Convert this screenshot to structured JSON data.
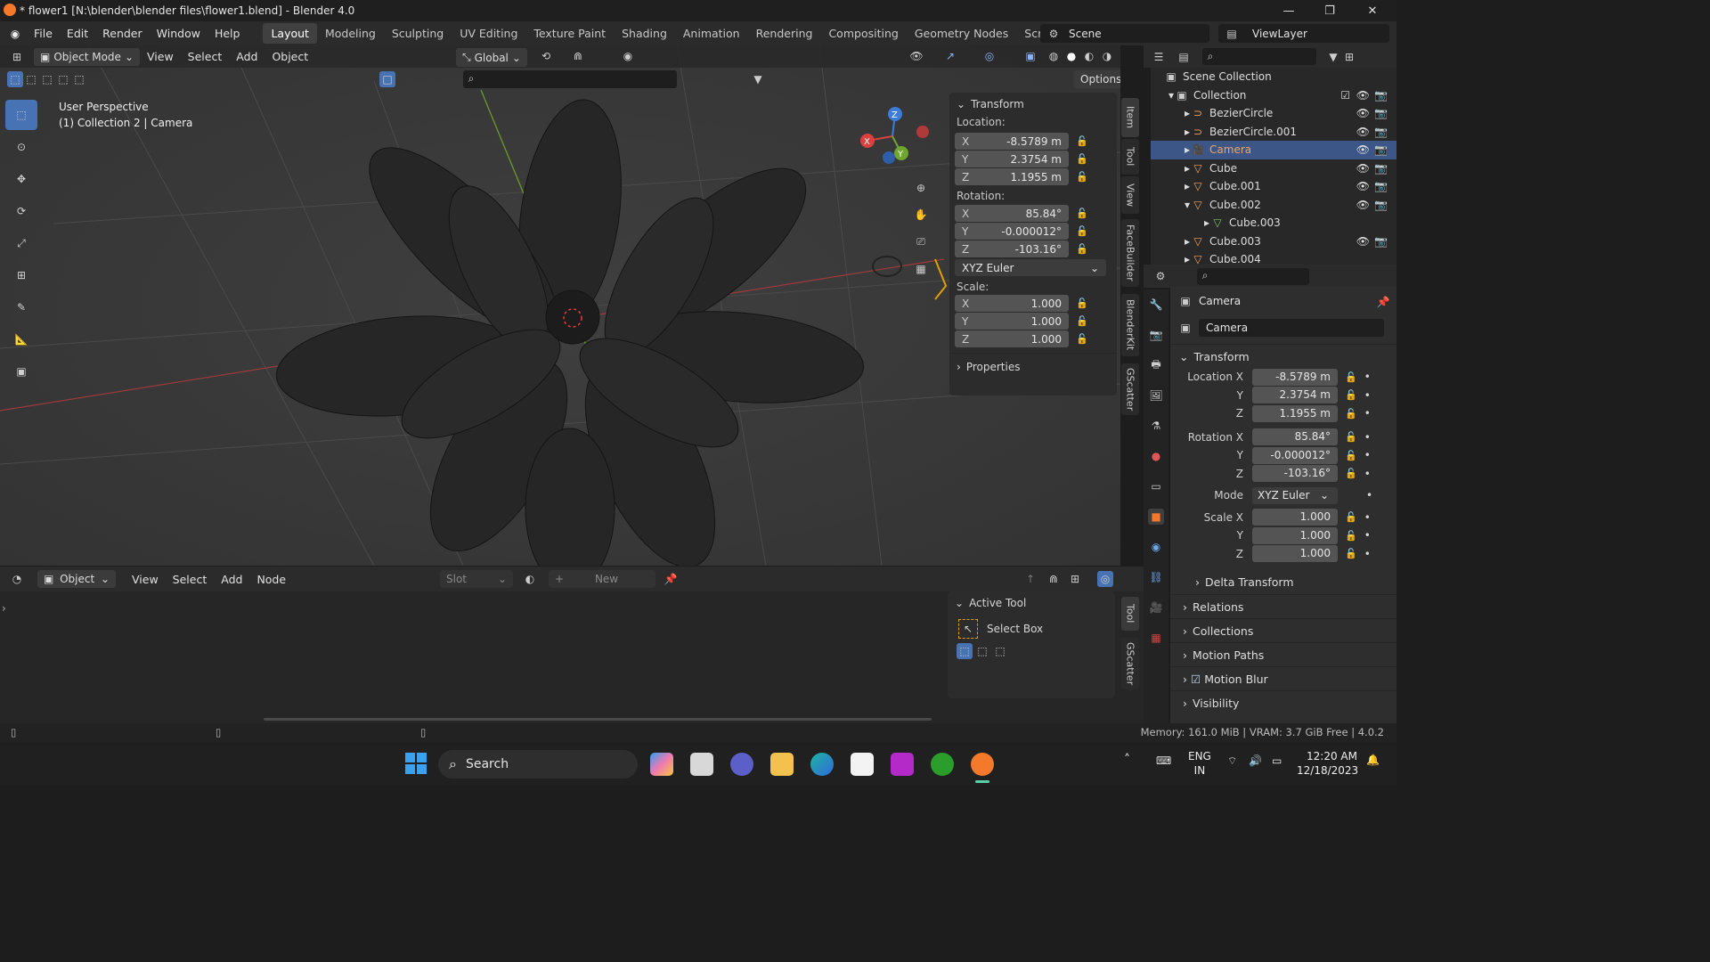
{
  "window": {
    "title": "* flower1 [N:\\blender\\blender files\\flower1.blend] - Blender 4.0",
    "min": "—",
    "max": "❐",
    "close": "✕"
  },
  "menubar": {
    "menus": [
      "File",
      "Edit",
      "Render",
      "Window",
      "Help"
    ],
    "workspaces": [
      "Layout",
      "Modeling",
      "Sculpting",
      "UV Editing",
      "Texture Paint",
      "Shading",
      "Animation",
      "Rendering",
      "Compositing",
      "Geometry Nodes",
      "Scripting"
    ],
    "add_workspace": "+",
    "scene": "Scene",
    "view_layer": "ViewLayer"
  },
  "viewport_header": {
    "mode": "Object Mode",
    "menus": [
      "View",
      "Select",
      "Add",
      "Object"
    ],
    "orientation": "Global",
    "options": "Options"
  },
  "viewport": {
    "overlay_line1": "User Perspective",
    "overlay_line2": "(1) Collection 2 | Camera",
    "gizmo": {
      "x": "X",
      "y": "Y",
      "z": "Z"
    }
  },
  "npanel": {
    "transform_title": "Transform",
    "location_label": "Location:",
    "location": [
      {
        "axis": "X",
        "value": "-8.5789 m"
      },
      {
        "axis": "Y",
        "value": "2.3754 m"
      },
      {
        "axis": "Z",
        "value": "1.1955 m"
      }
    ],
    "rotation_label": "Rotation:",
    "rotation": [
      {
        "axis": "X",
        "value": "85.84°"
      },
      {
        "axis": "Y",
        "value": "-0.000012°"
      },
      {
        "axis": "Z",
        "value": "-103.16°"
      }
    ],
    "rotation_mode": "XYZ Euler",
    "scale_label": "Scale:",
    "scale": [
      {
        "axis": "X",
        "value": "1.000"
      },
      {
        "axis": "Y",
        "value": "1.000"
      },
      {
        "axis": "Z",
        "value": "1.000"
      }
    ],
    "properties": "Properties",
    "tabs": [
      "Item",
      "Tool",
      "View",
      "FaceBuilder",
      "BlenderKit",
      "GScatter"
    ]
  },
  "outliner": {
    "scene_collection": "Scene Collection",
    "collection": "Collection",
    "items": [
      {
        "name": "BezierCircle"
      },
      {
        "name": "BezierCircle.001"
      },
      {
        "name": "Camera"
      },
      {
        "name": "Cube"
      },
      {
        "name": "Cube.001"
      },
      {
        "name": "Cube.002"
      },
      {
        "name": "Cube.003"
      },
      {
        "name": "Cube.003"
      },
      {
        "name": "Cube.004"
      }
    ]
  },
  "properties": {
    "object_name": "Camera",
    "datablock": "Camera",
    "transform": "Transform",
    "location": [
      {
        "label": "Location X",
        "value": "-8.5789 m"
      },
      {
        "label": "Y",
        "value": "2.3754 m"
      },
      {
        "label": "Z",
        "value": "1.1955 m"
      }
    ],
    "rotation": [
      {
        "label": "Rotation X",
        "value": "85.84°"
      },
      {
        "label": "Y",
        "value": "-0.000012°"
      },
      {
        "label": "Z",
        "value": "-103.16°"
      }
    ],
    "mode_label": "Mode",
    "mode_value": "XYZ Euler",
    "scale": [
      {
        "label": "Scale X",
        "value": "1.000"
      },
      {
        "label": "Y",
        "value": "1.000"
      },
      {
        "label": "Z",
        "value": "1.000"
      }
    ],
    "sections": [
      "Delta Transform",
      "Relations",
      "Collections",
      "Motion Paths",
      "Motion Blur",
      "Visibility"
    ]
  },
  "shader_editor": {
    "mode": "Object",
    "menus": [
      "View",
      "Select",
      "Add",
      "Node"
    ],
    "slot": "Slot",
    "new": "New",
    "active_tool_title": "Active Tool",
    "select_box": "Select Box",
    "tabs": [
      "Tool",
      "GScatter"
    ]
  },
  "statusbar": {
    "memory": "Memory: 161.0 MiB | VRAM: 3.7 GiB Free | 4.0.2"
  },
  "taskbar": {
    "search": "Search",
    "lang1": "ENG",
    "lang2": "IN",
    "time": "12:20 AM",
    "date": "12/18/2023"
  },
  "colors": {
    "accent": "#4772b3",
    "selection": "#3c5687",
    "blender_orange": "#f5792a"
  }
}
